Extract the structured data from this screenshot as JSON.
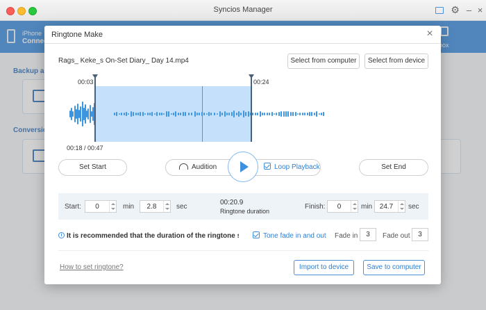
{
  "window": {
    "title": "Syncios Manager"
  },
  "app": {
    "device_name": "iPhone",
    "device_status": "Connec",
    "section_backup": "Backup an",
    "section_conversion": "Conversion",
    "toolbox_label": "box"
  },
  "dialog": {
    "title": "Ringtone Make",
    "close_glyph": "×",
    "file_name": "Rags_ Keke_s On-Set Diary_ Day 14.mp4",
    "select_computer_label": "Select from computer",
    "select_device_label": "Select from device",
    "waveform": {
      "start_time_label": "00:03",
      "end_time_label": "00:24",
      "progress_label": "00:18 / 00:47"
    },
    "controls": {
      "set_start_label": "Set Start",
      "audition_label": "Audition",
      "loop_label": "Loop Playback",
      "loop_checked": true,
      "set_end_label": "Set End"
    },
    "duration": {
      "start_label": "Start:",
      "start_min": "0",
      "start_sec": "2.8",
      "min_unit": "min",
      "sec_unit": "sec",
      "duration_value": "00:20.9",
      "duration_label": "Ringtone duration",
      "finish_label": "Finish:",
      "finish_min": "0",
      "finish_sec": "24.7"
    },
    "recommendation": {
      "info_glyph": "i",
      "text": "It is recommended that the duration of the ringtone shou...",
      "fade_label": "Tone fade in and out",
      "fade_checked": true,
      "fade_in_label": "Fade in",
      "fade_in_value": "3",
      "fade_out_label": "Fade out",
      "fade_out_value": "3"
    },
    "footer": {
      "help_link": "How to set ringtone?",
      "import_label": "Import to device",
      "save_label": "Save to computer"
    }
  },
  "colors": {
    "accent": "#3d8fe0",
    "selection": "#c4e0fb",
    "playhead": "#e06a36"
  }
}
